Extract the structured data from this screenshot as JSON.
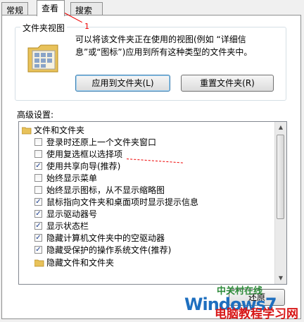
{
  "tabs": [
    {
      "label": "常规"
    },
    {
      "label": "查看"
    },
    {
      "label": "搜索"
    }
  ],
  "folder_views": {
    "title": "文件夹视图",
    "description": "可以将该文件夹正在使用的视图(例如 “详细信息”或“图标”)应用到所有这种类型的文件夹中。",
    "apply_button": "应用到文件夹(L)",
    "reset_button": "重置文件夹(R)"
  },
  "advanced": {
    "label": "高级设置:",
    "items": [
      {
        "type": "folder",
        "label": "文件和文件夹"
      },
      {
        "type": "check",
        "checked": false,
        "label": "登录时还原上一个文件夹窗口"
      },
      {
        "type": "check",
        "checked": false,
        "label": "使用复选框以选择项"
      },
      {
        "type": "check",
        "checked": true,
        "label": "使用共享向导(推荐)"
      },
      {
        "type": "check",
        "checked": false,
        "label": "始终显示菜单"
      },
      {
        "type": "check",
        "checked": false,
        "label": "始终显示图标，从不显示缩略图"
      },
      {
        "type": "check",
        "checked": true,
        "label": "鼠标指向文件夹和桌面项时显示提示信息"
      },
      {
        "type": "check",
        "checked": true,
        "label": "显示驱动器号"
      },
      {
        "type": "check",
        "checked": true,
        "label": "显示状态栏"
      },
      {
        "type": "check",
        "checked": true,
        "label": "隐藏计算机文件夹中的空驱动器"
      },
      {
        "type": "check",
        "checked": true,
        "label": "隐藏受保护的操作系统文件(推荐)"
      },
      {
        "type": "folder",
        "label": "隐藏文件和文件夹"
      }
    ]
  },
  "restore_button": "还原",
  "annotations": {
    "callout_number": "1"
  },
  "watermark": {
    "line1": "中关村在线",
    "line2": "Windows7",
    "line3": "电脑教程学习网"
  },
  "colors": {
    "accent_red": "#e00000",
    "watermark_blue": "#1e6fbf",
    "watermark_red": "#d81818"
  }
}
